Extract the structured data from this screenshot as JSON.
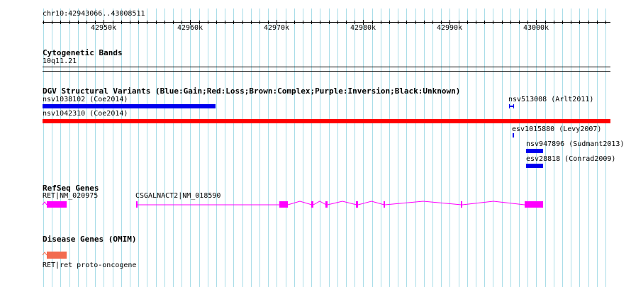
{
  "region": {
    "label": "chr10:42943066..43008511"
  },
  "ruler": {
    "ticks": [
      "42950k",
      "42960k",
      "42970k",
      "42980k",
      "42990k",
      "43000k"
    ]
  },
  "tracks": {
    "cytoband": {
      "title": "Cytogenetic Bands",
      "band_label": "10q11.21"
    },
    "dgv": {
      "title": "DGV Structural Variants (Blue:Gain;Red:Loss;Brown:Complex;Purple:Inversion;Black:Unknown)",
      "features": [
        {
          "label": "nsv1038102 (Coe2014)",
          "type": "gain"
        },
        {
          "label": "nsv513008 (Arlt2011)",
          "type": "gain"
        },
        {
          "label": "nsv1042310 (Coe2014)",
          "type": "loss"
        },
        {
          "label": "esv1015880 (Levy2007)",
          "type": "gain"
        },
        {
          "label": "nsv947896 (Sudmant2013)",
          "type": "gain"
        },
        {
          "label": "esv28818 (Conrad2009)",
          "type": "gain"
        }
      ]
    },
    "refseq": {
      "title": "RefSeq Genes",
      "genes": [
        {
          "label": "RET|NM_020975"
        },
        {
          "label": "CSGALNACT2|NM_018590"
        }
      ]
    },
    "omim": {
      "title": "Disease Genes (OMIM)",
      "genes": [
        {
          "label": "RET|ret proto-oncogene"
        }
      ]
    }
  },
  "colors": {
    "gain": "#0000ee",
    "loss": "#ff0000",
    "gene": "#ff00ff",
    "omim": "#f26b4f",
    "grid": "#a9dde8"
  }
}
